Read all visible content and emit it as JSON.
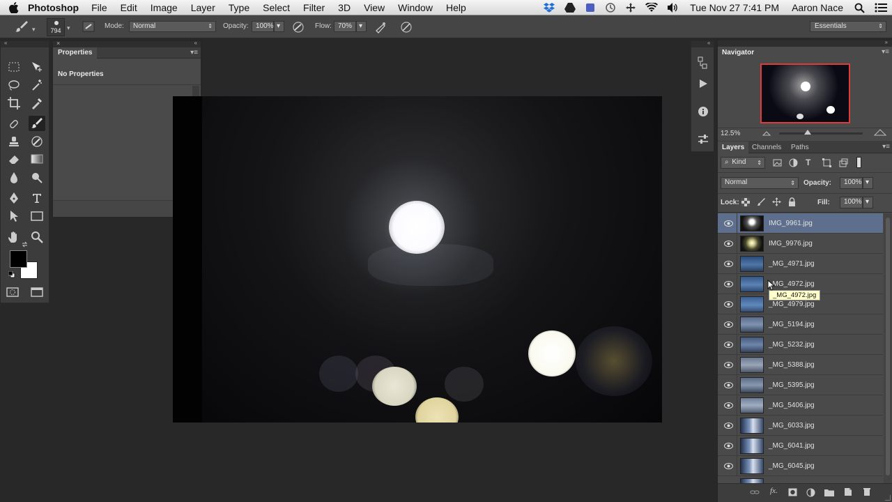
{
  "menubar": {
    "app_name": "Photoshop",
    "menus": [
      "File",
      "Edit",
      "Image",
      "Layer",
      "Type",
      "Select",
      "Filter",
      "3D",
      "View",
      "Window",
      "Help"
    ],
    "clock": "Tue Nov 27  7:41 PM",
    "user": "Aaron Nace"
  },
  "options": {
    "brush_size": "794",
    "mode_label": "Mode:",
    "mode_value": "Normal",
    "opacity_label": "Opacity:",
    "opacity_value": "100%",
    "flow_label": "Flow:",
    "flow_value": "70%",
    "workspace": "Essentials"
  },
  "properties": {
    "tab": "Properties",
    "message": "No Properties"
  },
  "navigator": {
    "tab": "Navigator",
    "zoom": "12.5%"
  },
  "layers_panel": {
    "tabs": [
      "Layers",
      "Channels",
      "Paths"
    ],
    "filter_kind": "Kind",
    "blend_mode": "Normal",
    "opacity_label": "Opacity:",
    "opacity_value": "100%",
    "lock_label": "Lock:",
    "fill_label": "Fill:",
    "fill_value": "100%",
    "tooltip": "_MG_4972.jpg",
    "layers": [
      {
        "name": "IMG_9961.jpg"
      },
      {
        "name": "IMG_9976.jpg"
      },
      {
        "name": "_MG_4971.jpg"
      },
      {
        "name": "_MG_4972.jpg"
      },
      {
        "name": "_MG_4979.jpg"
      },
      {
        "name": "_MG_5194.jpg"
      },
      {
        "name": "_MG_5232.jpg"
      },
      {
        "name": "_MG_5388.jpg"
      },
      {
        "name": "_MG_5395.jpg"
      },
      {
        "name": "_MG_5406.jpg"
      },
      {
        "name": "_MG_6033.jpg"
      },
      {
        "name": "_MG_6041.jpg"
      },
      {
        "name": "_MG_6045.jpg"
      }
    ]
  }
}
